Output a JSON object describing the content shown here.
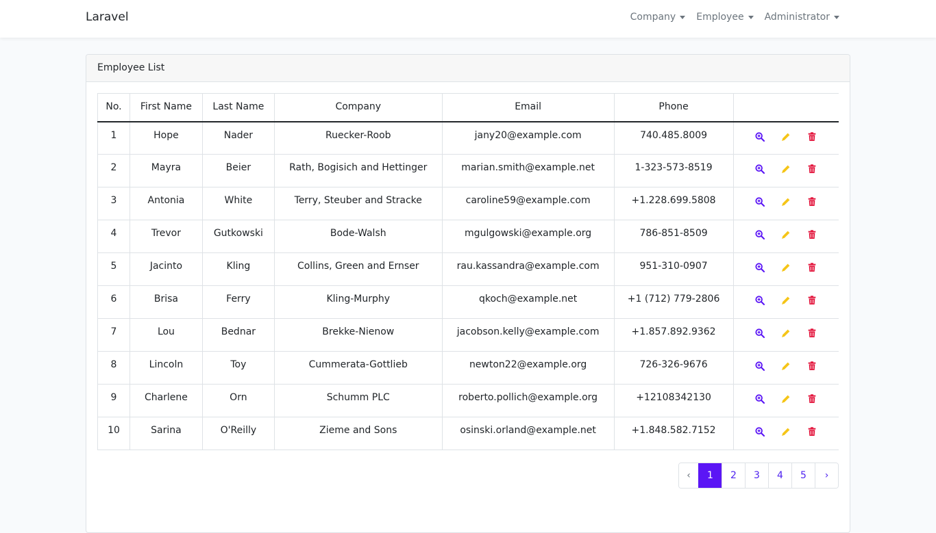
{
  "navbar": {
    "brand": "Laravel",
    "menu": [
      "Company",
      "Employee",
      "Administrator"
    ]
  },
  "card": {
    "title": "Employee List"
  },
  "table": {
    "headers": [
      "No.",
      "First Name",
      "Last Name",
      "Company",
      "Email",
      "Phone",
      ""
    ],
    "rows": [
      [
        "1",
        "Hope",
        "Nader",
        "Ruecker-Roob",
        "jany20@example.com",
        "740.485.8009"
      ],
      [
        "2",
        "Mayra",
        "Beier",
        "Rath, Bogisich and Hettinger",
        "marian.smith@example.net",
        "1-323-573-8519"
      ],
      [
        "3",
        "Antonia",
        "White",
        "Terry, Steuber and Stracke",
        "caroline59@example.com",
        "+1.228.699.5808"
      ],
      [
        "4",
        "Trevor",
        "Gutkowski",
        "Bode-Walsh",
        "mgulgowski@example.org",
        "786-851-8509"
      ],
      [
        "5",
        "Jacinto",
        "Kling",
        "Collins, Green and Ernser",
        "rau.kassandra@example.com",
        "951-310-0907"
      ],
      [
        "6",
        "Brisa",
        "Ferry",
        "Kling-Murphy",
        "qkoch@example.net",
        "+1 (712) 779-2806"
      ],
      [
        "7",
        "Lou",
        "Bednar",
        "Brekke-Nienow",
        "jacobson.kelly@example.com",
        "+1.857.892.9362"
      ],
      [
        "8",
        "Lincoln",
        "Toy",
        "Cummerata-Gottlieb",
        "newton22@example.org",
        "726-326-9676"
      ],
      [
        "9",
        "Charlene",
        "Orn",
        "Schumm PLC",
        "roberto.pollich@example.org",
        "+12108342130"
      ],
      [
        "10",
        "Sarina",
        "O'Reilly",
        "Zieme and Sons",
        "osinski.orland@example.net",
        "+1.848.582.7152"
      ]
    ],
    "actions": [
      {
        "icon": "zoom-in-icon",
        "color": "#5b16f5"
      },
      {
        "icon": "pencil-icon",
        "color": "#f5c518"
      },
      {
        "icon": "trash-icon",
        "color": "#e3173e"
      }
    ]
  },
  "pagination": {
    "prev": "‹",
    "pages": [
      "1",
      "2",
      "3",
      "4",
      "5"
    ],
    "active": "1",
    "next": "›"
  }
}
